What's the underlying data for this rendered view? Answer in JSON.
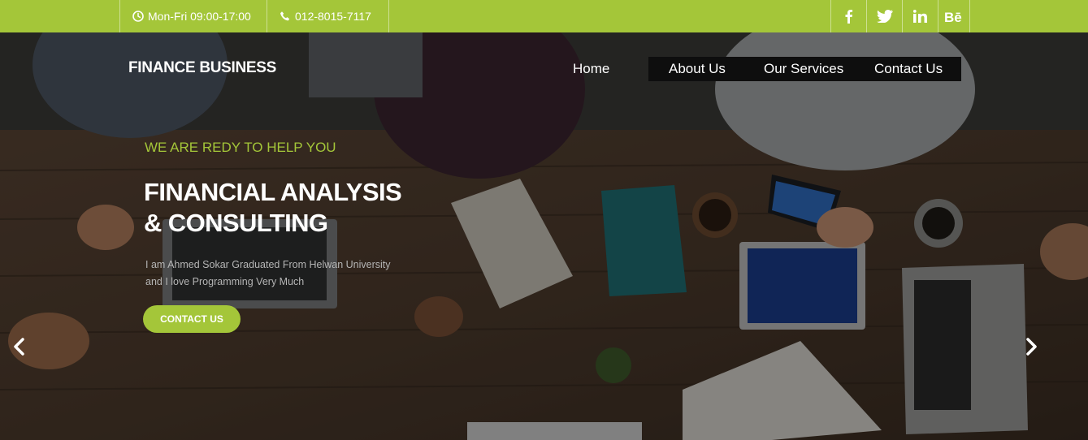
{
  "topbar": {
    "hours": "Mon-Fri 09:00-17:00",
    "phone": "012-8015-7117",
    "social": [
      "f",
      "t",
      "in",
      "Bē"
    ],
    "accent": "#a4c639"
  },
  "brand": "FINANCE BUSINESS",
  "nav": {
    "items": [
      "Home",
      "About Us",
      "Our Services",
      "Contact Us"
    ]
  },
  "hero": {
    "kicker": "WE ARE REDY TO HELP YOU",
    "headline_line1": "FINANCIAL ANALYSIS",
    "headline_line2": "& CONSULTING",
    "desc_line1": "I am Ahmed Sokar Graduated From Helwan University",
    "desc_line2": "and I love Programming Very Much",
    "cta": "CONTACT US"
  },
  "icons": {
    "hours": "clock-icon",
    "phone": "phone-icon",
    "prev": "chevron-left-icon",
    "next": "chevron-right-icon"
  }
}
